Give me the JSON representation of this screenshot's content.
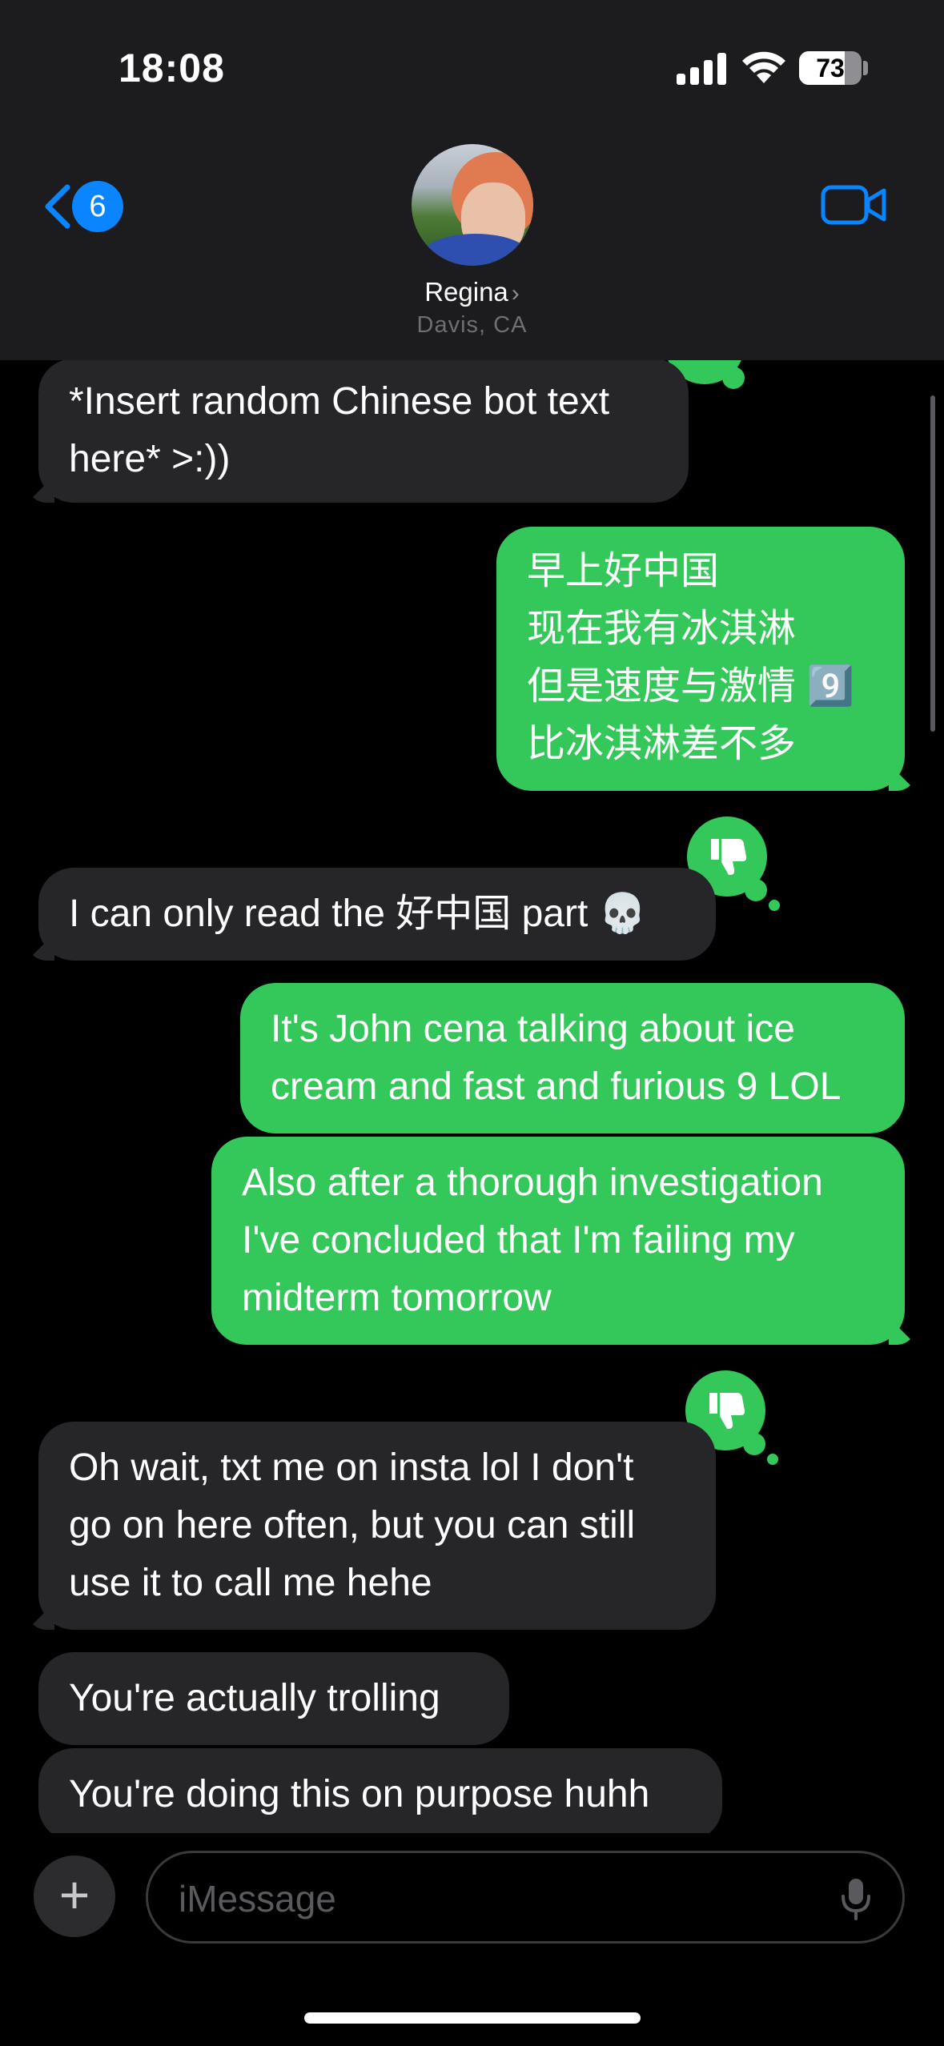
{
  "status_bar": {
    "time": "18:08",
    "battery_level": 73,
    "battery_label": "73"
  },
  "header": {
    "back_badge": "6",
    "contact_name": "Regina",
    "contact_location": "Davis, CA",
    "back_icon": "chevron-left-icon",
    "video_icon": "video-camera-icon"
  },
  "messages": [
    {
      "side": "received",
      "lines": [
        "*Insert random Chinese bot text",
        "here* >:))"
      ]
    },
    {
      "side": "sent",
      "lines": [
        "早上好中国",
        "现在我有冰淇淋",
        "但是速度与激情 9️⃣",
        "比冰淇淋差不多"
      ],
      "tapback": "thumbs-down-icon"
    },
    {
      "side": "received",
      "lines": [
        "I can only read the 好中国 part 💀"
      ]
    },
    {
      "side": "sent",
      "lines": [
        "It's John cena talking about ice",
        "cream and fast and furious 9 LOL"
      ]
    },
    {
      "side": "sent",
      "lines": [
        "Also after a thorough investigation",
        "I've concluded that I'm failing my",
        "midterm tomorrow"
      ],
      "tapback": "thumbs-down-icon"
    },
    {
      "side": "received",
      "lines": [
        "Oh wait, txt me on insta lol I don't",
        "go on here often, but you can still",
        "use it to call me hehe"
      ]
    },
    {
      "side": "received",
      "lines": [
        "You're actually trolling"
      ]
    },
    {
      "side": "received",
      "lines": [
        "You're doing this on purpose huhh"
      ]
    }
  ],
  "compose": {
    "plus_label": "+",
    "placeholder": "iMessage",
    "mic_icon": "microphone-icon"
  },
  "colors": {
    "sent": "#34c759",
    "received": "#262629",
    "accent": "#0a84ff"
  }
}
